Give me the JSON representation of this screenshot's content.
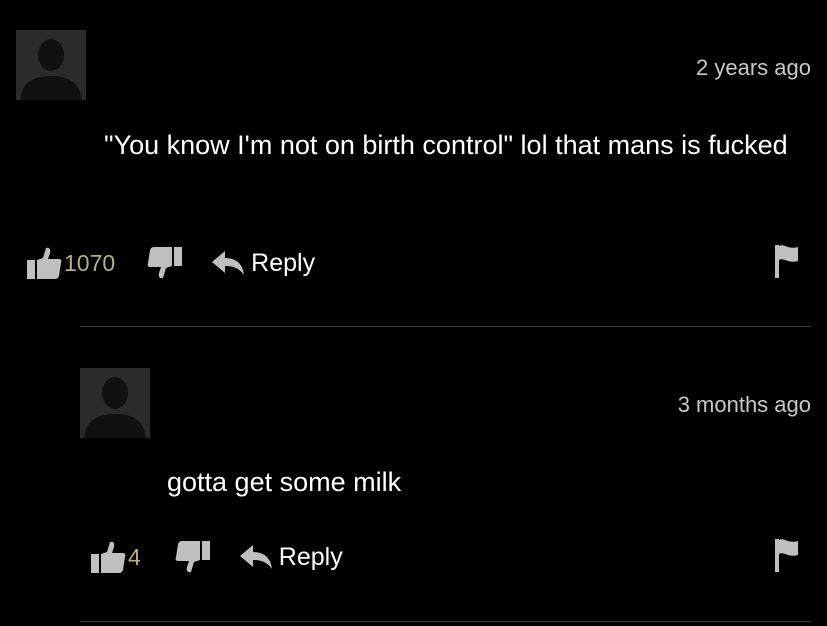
{
  "comments": [
    {
      "timestamp": "2 years ago",
      "text": "\"You know I'm not on birth control\" lol that mans is fucked",
      "likes": "1070",
      "reply_label": "Reply"
    },
    {
      "timestamp": "3 months ago",
      "text": "gotta get some milk",
      "likes": "4",
      "reply_label": "Reply"
    }
  ],
  "icons": {
    "avatar": "user-silhouette-icon",
    "like": "thumbs-up-icon",
    "dislike": "thumbs-down-icon",
    "reply": "reply-arrow-icon",
    "flag": "flag-icon"
  },
  "colors": {
    "background": "#000000",
    "vote_count": "#b3b27a",
    "icon": "#bfbfbf",
    "divider": "#3a3a3a"
  }
}
